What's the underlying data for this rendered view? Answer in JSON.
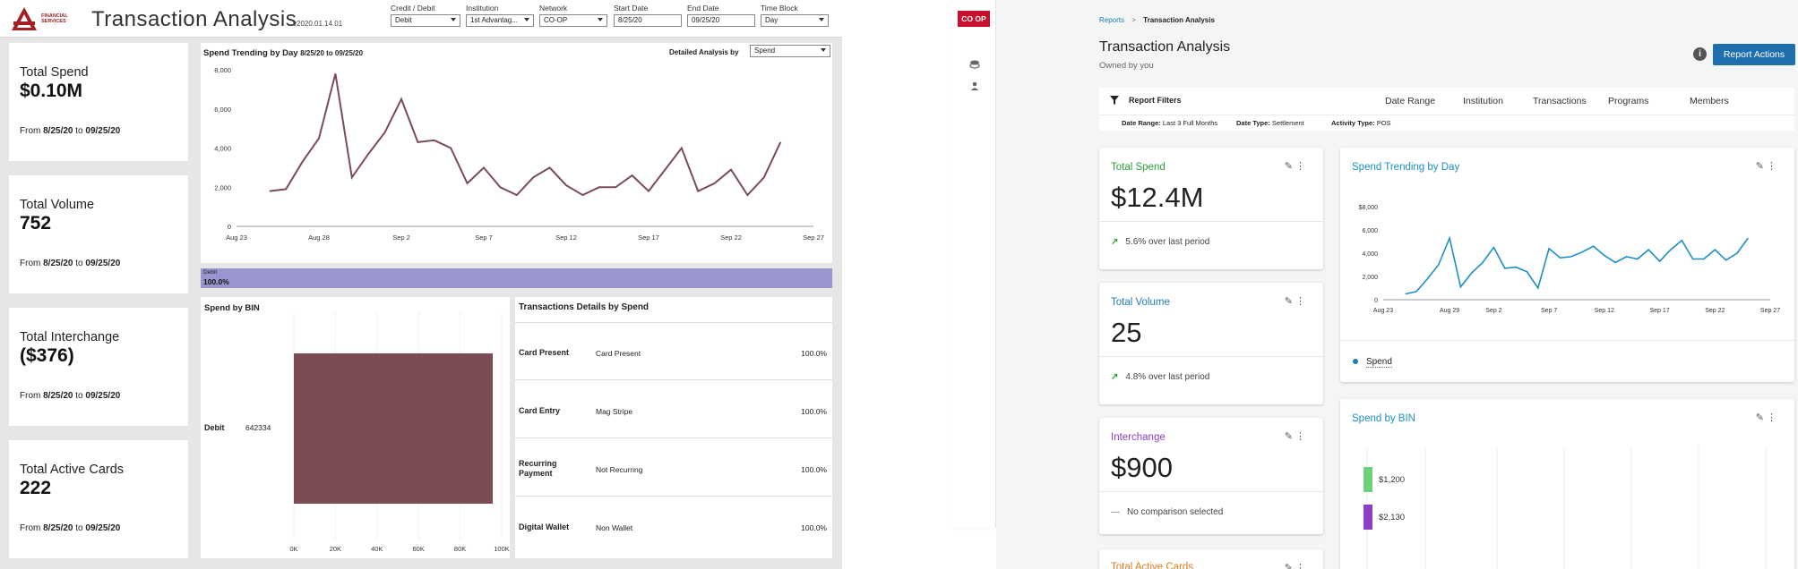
{
  "left": {
    "logo_text": "FINANCIAL SERVICES",
    "title": "Transaction Analysis",
    "version": "v2020.01.14.01",
    "filters": [
      {
        "label": "Credit / Debit",
        "value": "Debit",
        "dropdown": true
      },
      {
        "label": "Institution",
        "value": "1st Advantag...",
        "dropdown": true
      },
      {
        "label": "Network",
        "value": "CO-OP",
        "dropdown": true
      },
      {
        "label": "Start Date",
        "value": "8/25/20",
        "dropdown": false
      },
      {
        "label": "End Date",
        "value": "09/25/20",
        "dropdown": false
      },
      {
        "label": "Time Block",
        "value": "Day",
        "dropdown": true
      }
    ],
    "kpis": [
      {
        "title": "Total Spend",
        "value": "$0.10M",
        "from": "From ",
        "start": "8/25/20",
        "to": " to ",
        "end": "09/25/20"
      },
      {
        "title": "Total Volume",
        "value": "752",
        "from": "From ",
        "start": "8/25/20",
        "to": " to ",
        "end": "09/25/20"
      },
      {
        "title": "Total Interchange",
        "value": "($376)",
        "from": "From ",
        "start": "8/25/20",
        "to": " to ",
        "end": "09/25/20"
      },
      {
        "title": "Total Active Cards",
        "value": "222",
        "from": "From ",
        "start": "8/25/20",
        "to": " to ",
        "end": "09/25/20"
      }
    ],
    "trend": {
      "title": "Spend Trending by Day",
      "subtitle": "8/25/20 to 09/25/20",
      "detail_label": "Detailed Analysis by",
      "detail_value": "Spend"
    },
    "debit_bar": {
      "label": "Debit",
      "value": "100.0%"
    },
    "bin": {
      "title": "Spend by BIN",
      "row_label": "Debit",
      "row_bin": "642334"
    },
    "tx": {
      "title": "Transactions Details by Spend",
      "rows": [
        {
          "category": "Card Present",
          "value": "Card Present",
          "pct": "100.0%"
        },
        {
          "category": "Card Entry",
          "value": "Mag Stripe",
          "pct": "100.0%"
        },
        {
          "category": "Recurring Payment",
          "value": "Not Recurring",
          "pct": "100.0%"
        },
        {
          "category": "Digital Wallet",
          "value": "Non Wallet",
          "pct": "100.0%"
        }
      ]
    }
  },
  "right": {
    "logo": "CO OP",
    "breadcrumb": {
      "root": "Reports",
      "separator": ">",
      "current": "Transaction Analysis"
    },
    "title": "Transaction Analysis",
    "owner": "Owned by you",
    "report_actions": "Report Actions",
    "filters_label": "Report Filters",
    "tabs": [
      "Date Range",
      "Institution",
      "Transactions",
      "Programs",
      "Members"
    ],
    "pills": [
      {
        "key": "Date Range:",
        "val": "Last 3 Full Months"
      },
      {
        "key": "Date Type:",
        "val": "Settlement"
      },
      {
        "key": "Activity Type:",
        "val": "POS"
      }
    ],
    "kpis": [
      {
        "title": "Total Spend",
        "value": "$12.4M",
        "compare": "5.6% over last period",
        "color": "#2e9e3a"
      },
      {
        "title": "Total Volume",
        "value": "25",
        "compare": "4.8% over last period",
        "color": "#1b7fb3"
      },
      {
        "title": "Interchange",
        "value": "$900",
        "compare": "No comparison selected",
        "color": "#8a3fc6"
      },
      {
        "title": "Total Active Cards",
        "color": "#e07a1f"
      }
    ],
    "trend_title": "Spend Trending by Day",
    "trend_legend": "Spend",
    "bin_title": "Spend by BIN",
    "colors": {
      "accent": "#1b7fb3",
      "button": "#1f6fae",
      "coop_red": "#c8102e"
    }
  },
  "chart_data": [
    {
      "type": "line",
      "title": "Spend Trending by Day",
      "x": [
        "Aug 23",
        "Aug 24",
        "Aug 25",
        "Aug 26",
        "Aug 27",
        "Aug 28",
        "Aug 29",
        "Aug 30",
        "Aug 31",
        "Sep 1",
        "Sep 2",
        "Sep 3",
        "Sep 4",
        "Sep 5",
        "Sep 6",
        "Sep 7",
        "Sep 8",
        "Sep 9",
        "Sep 10",
        "Sep 11",
        "Sep 12",
        "Sep 13",
        "Sep 14",
        "Sep 15",
        "Sep 16",
        "Sep 17",
        "Sep 18",
        "Sep 19",
        "Sep 20",
        "Sep 21",
        "Sep 22",
        "Sep 23",
        "Sep 24",
        "Sep 25",
        "Sep 26",
        "Sep 27"
      ],
      "xticks": [
        "Aug 23",
        "Aug 28",
        "Sep 2",
        "Sep 7",
        "Sep 12",
        "Sep 17",
        "Sep 22",
        "Sep 27"
      ],
      "series": [
        {
          "values": [
            null,
            null,
            1800,
            1900,
            3300,
            4500,
            7800,
            2500,
            3700,
            4800,
            6500,
            4300,
            4400,
            4000,
            2200,
            3000,
            2000,
            1600,
            2500,
            3000,
            2100,
            1600,
            2000,
            2000,
            2600,
            1800,
            2900,
            4000,
            1800,
            2200,
            2900,
            1600,
            2500,
            4300,
            null,
            null
          ]
        }
      ],
      "ylim": [
        0,
        8000
      ],
      "yticks": [
        "0",
        "2,000",
        "4,000",
        "6,000",
        "8,000"
      ],
      "color": "#7b4b56"
    },
    {
      "type": "bar",
      "title": "Spend by BIN",
      "categories": [
        "Debit 642334"
      ],
      "values": [
        100000
      ],
      "xticks": [
        "0K",
        "20K",
        "40K",
        "60K",
        "80K",
        "100K"
      ],
      "xlim": [
        0,
        100000
      ],
      "color": "#7c4c54"
    },
    {
      "type": "line",
      "title": "Spend Trending by Day",
      "x": [
        "Aug 23",
        "Aug 24",
        "Aug 25",
        "Aug 26",
        "Aug 27",
        "Aug 28",
        "Aug 29",
        "Aug 30",
        "Aug 31",
        "Sep 1",
        "Sep 2",
        "Sep 3",
        "Sep 4",
        "Sep 5",
        "Sep 6",
        "Sep 7",
        "Sep 8",
        "Sep 9",
        "Sep 10",
        "Sep 11",
        "Sep 12",
        "Sep 13",
        "Sep 14",
        "Sep 15",
        "Sep 16",
        "Sep 17",
        "Sep 18",
        "Sep 19",
        "Sep 20",
        "Sep 21",
        "Sep 22",
        "Sep 23",
        "Sep 24",
        "Sep 25",
        "Sep 26",
        "Sep 27"
      ],
      "xticks": [
        "Aug 23",
        "Aug 29",
        "Sep 2",
        "Sep 7",
        "Sep 12",
        "Sep 17",
        "Sep 22",
        "Sep 27"
      ],
      "series": [
        {
          "name": "Spend",
          "values": [
            null,
            null,
            500,
            700,
            1800,
            3000,
            5300,
            1100,
            2300,
            3200,
            4500,
            2700,
            2800,
            2400,
            1000,
            4400,
            3600,
            3700,
            4100,
            4600,
            3800,
            3200,
            3700,
            3500,
            4300,
            3300,
            4300,
            5100,
            3500,
            3500,
            4300,
            3400,
            4000,
            5300,
            null,
            null
          ]
        }
      ],
      "ylim": [
        0,
        8000
      ],
      "yticks": [
        "0",
        "2,000",
        "4,000",
        "6,000",
        "$8,000"
      ],
      "color": "#1b8fc2"
    },
    {
      "type": "bar",
      "title": "Spend by BIN",
      "categories": [
        "",
        ""
      ],
      "values": [
        1200,
        2130
      ],
      "labels": [
        "$1,200",
        "$2,130"
      ],
      "colors": [
        "#6fd07a",
        "#8a3fc6"
      ]
    }
  ]
}
